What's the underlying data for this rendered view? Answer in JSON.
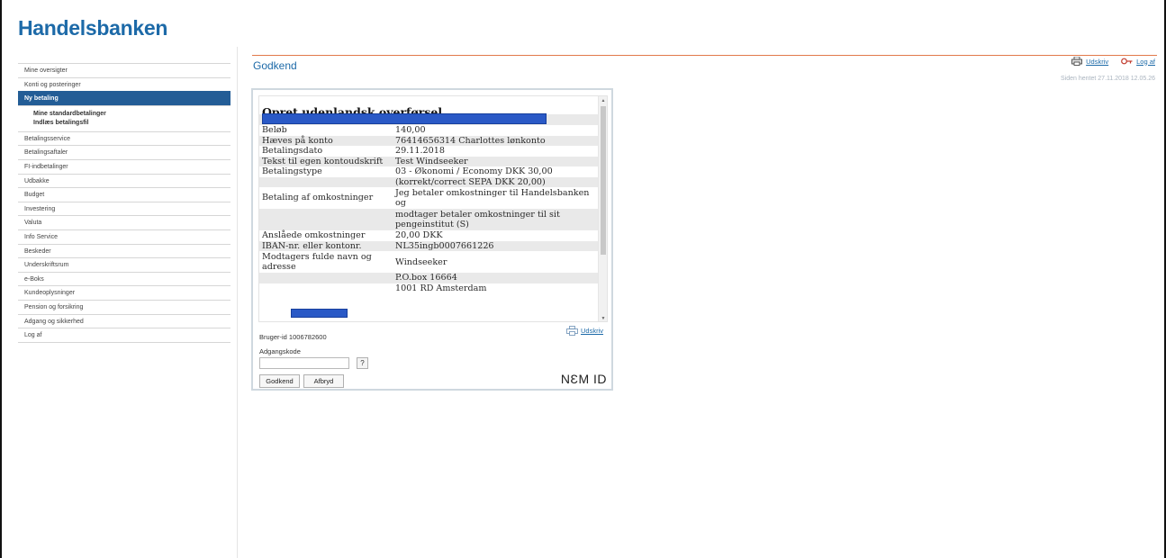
{
  "app": {
    "logo": "Handelsbanken"
  },
  "sidebar": {
    "items": [
      {
        "label": "Mine oversigter"
      },
      {
        "label": "Konti og posteringer"
      },
      {
        "label": "Ny betaling"
      },
      {
        "label": "Betalingsservice"
      },
      {
        "label": "Betalingsaftaler"
      },
      {
        "label": "FI-indbetalinger"
      },
      {
        "label": "Udbakke"
      },
      {
        "label": "Budget"
      },
      {
        "label": "Investering"
      },
      {
        "label": "Valuta"
      },
      {
        "label": "Info Service"
      },
      {
        "label": "Beskeder"
      },
      {
        "label": "Underskriftsrum"
      },
      {
        "label": "e-Boks"
      },
      {
        "label": "Kundeoplysninger"
      },
      {
        "label": "Pension og forsikring"
      },
      {
        "label": "Adgang og sikkerhed"
      },
      {
        "label": "Log af"
      }
    ],
    "subitems": [
      {
        "label": "Mine standardbetalinger"
      },
      {
        "label": "Indlæs betalingsfil"
      }
    ]
  },
  "header": {
    "title": "Godkend",
    "print_label": "Udskriv",
    "logout_label": "Log af",
    "timestamp": "Siden hentet 27.11.2018 12.05.26"
  },
  "transfer": {
    "heading": "Opret udenlandsk overførsel",
    "rows": [
      {
        "label": "Beløb",
        "value": "140,00"
      },
      {
        "label": "Hæves på konto",
        "value": "76414656314 Charlottes lønkonto"
      },
      {
        "label": "Betalingsdato",
        "value": "29.11.2018"
      },
      {
        "label": "Tekst til egen kontoudskrift",
        "value": "Test Windseeker"
      },
      {
        "label": "Betalingstype",
        "value": "03 - Økonomi / Economy DKK 30,00"
      },
      {
        "label": "",
        "value": "(korrekt/correct SEPA DKK 20,00)"
      },
      {
        "label": "Betaling af omkostninger",
        "value": "Jeg betaler omkostninger til Handelsbanken og"
      },
      {
        "label": "",
        "value": "modtager betaler omkostninger til sit pengeinstitut (S)"
      },
      {
        "label": "Anslåede omkostninger",
        "value": "20,00 DKK"
      },
      {
        "label": "IBAN-nr. eller kontonr.",
        "value": "NL35ingb0007661226"
      },
      {
        "label": "Modtagers fulde navn og adresse",
        "value": "Windseeker"
      },
      {
        "label": "",
        "value": "P.O.box 16664"
      },
      {
        "label": "",
        "value": "1001 RD Amsterdam"
      }
    ]
  },
  "nemid": {
    "print_label": "Udskriv",
    "user_id": "Bruger-id  1006782600",
    "password_label": "Adgangskode",
    "password_value": "",
    "help_label": "?",
    "approve_label": "Godkend",
    "cancel_label": "Afbryd",
    "brand": "NƐM ID"
  },
  "colors": {
    "brand_blue": "#1d6aa8",
    "active_nav": "#235d96",
    "accent_orange": "#e27a4b",
    "redaction": "#2a59c6"
  }
}
